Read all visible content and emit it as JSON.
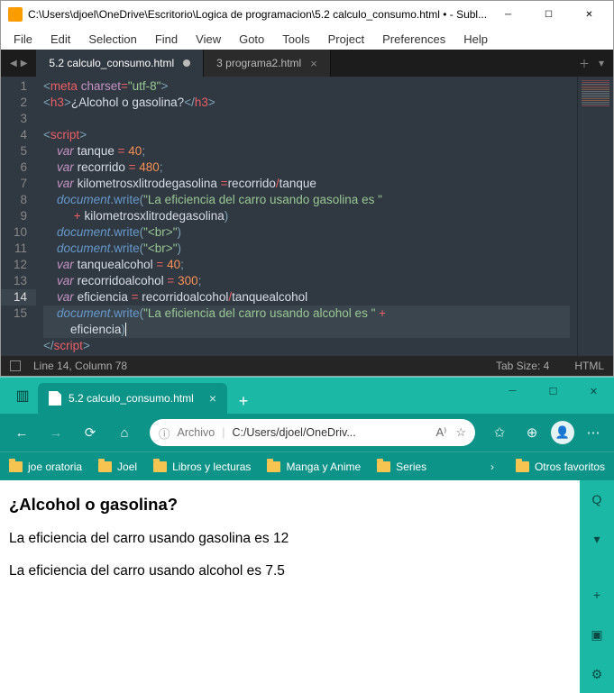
{
  "sublime": {
    "title": "C:\\Users\\djoel\\OneDrive\\Escritorio\\Logica de programacion\\5.2 calculo_consumo.html • - Subl...",
    "menu": [
      "File",
      "Edit",
      "Selection",
      "Find",
      "View",
      "Goto",
      "Tools",
      "Project",
      "Preferences",
      "Help"
    ],
    "tabs": [
      {
        "label": "5.2 calculo_consumo.html",
        "active": true,
        "dirty": true
      },
      {
        "label": "3 programa2.html",
        "active": false,
        "dirty": false
      }
    ],
    "lines": [
      "1",
      "2",
      "3",
      "4",
      "5",
      "6",
      "7",
      "8",
      "",
      "9",
      "10",
      "11",
      "12",
      "13",
      "14",
      "",
      "15"
    ],
    "active_line_index": 13,
    "status": {
      "pos": "Line 14, Column 78",
      "tabsize": "Tab Size: 4",
      "syntax": "HTML"
    },
    "code": {
      "l1_tag": "meta",
      "l1_attr": "charset",
      "l1_val": "\"utf-8\"",
      "l2_tag": "h3",
      "l2_text": "¿Alcohol o gasolina?",
      "l4_tag": "script",
      "l5_kw": "var",
      "l5_name": "tanque",
      "l5_val": "40",
      "l6_kw": "var",
      "l6_name": "recorrido",
      "l6_val": "480",
      "l7_kw": "var",
      "l7_name": "kilometrosxlitrodegasolina",
      "l7_a": "recorrido",
      "l7_b": "tanque",
      "l8_obj": "document",
      "l8_meth": "write",
      "l8_str": "\"La eficiencia del carro usando gasolina es \"",
      "l8b_name": "kilometrosxlitrodegasolina",
      "l9_obj": "document",
      "l9_meth": "write",
      "l9_str": "\"<br>\"",
      "l10_obj": "document",
      "l10_meth": "write",
      "l10_str": "\"<br>\"",
      "l11_kw": "var",
      "l11_name": "tanquealcohol",
      "l11_val": "40",
      "l12_kw": "var",
      "l12_name": "recorridoalcohol",
      "l12_val": "300",
      "l13_kw": "var",
      "l13_name": "eficiencia",
      "l13_a": "recorridoalcohol",
      "l13_b": "tanquealcohol",
      "l14_obj": "document",
      "l14_meth": "write",
      "l14_str": "\"La eficiencia del carro usando alcohol es \"",
      "l14b_name": "eficiencia",
      "l15_tag": "script"
    }
  },
  "edge": {
    "tab_title": "5.2 calculo_consumo.html",
    "address_label": "Archivo",
    "address_path": "C:/Users/djoel/OneDriv...",
    "bookmarks": [
      "joe oratoria",
      "Joel",
      "Libros y lecturas",
      "Manga y Anime",
      "Series"
    ],
    "other_bookmarks": "Otros favoritos",
    "page": {
      "heading": "¿Alcohol o gasolina?",
      "line1": "La eficiencia del carro usando gasolina es 12",
      "line2": "La eficiencia del carro usando alcohol es 7.5"
    }
  }
}
